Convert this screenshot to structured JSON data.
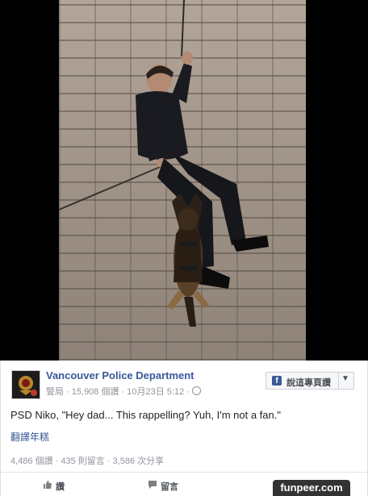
{
  "photo": {
    "subject": "K9 rappelling photo"
  },
  "post": {
    "page_name": "Vancouver Police Department",
    "meta": "警局 · 15,908 個讚 · 10月23日 5:12 · ",
    "follow_label": "說這專頁讚",
    "text": "PSD Niko, \"Hey dad... This rappelling? Yuh, I'm not a fan.\"",
    "translate_link": "翻譯年糕",
    "stats": "4,486 個讚 · 435 則留言 · 3,586 次分享",
    "actions": {
      "like_label": "讚",
      "comment_label": "留言"
    }
  },
  "watermark": "funpeer.com",
  "colors": {
    "link": "#365899",
    "text": "#1d2129",
    "muted": "#90949c",
    "fb_blue": "#3b5998"
  }
}
